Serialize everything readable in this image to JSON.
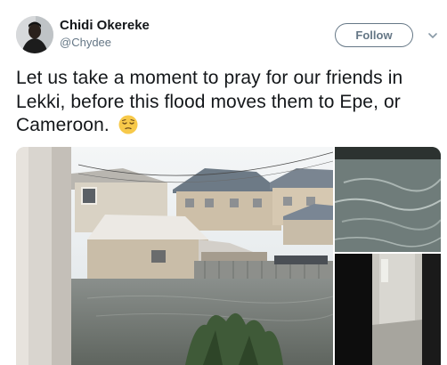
{
  "user": {
    "display_name": "Chidi Okereke",
    "handle": "@Chydee"
  },
  "actions": {
    "follow_label": "Follow"
  },
  "tweet": {
    "text": "Let us take a moment to pray for our friends in Lekki, before this flood moves them to Epe, or Cameroon.",
    "emoji": "pensive-face"
  },
  "colors": {
    "primary_text": "#14171a",
    "secondary_text": "#657786",
    "emoji_yellow": "#f7c94a"
  },
  "media": {
    "count": 3
  }
}
